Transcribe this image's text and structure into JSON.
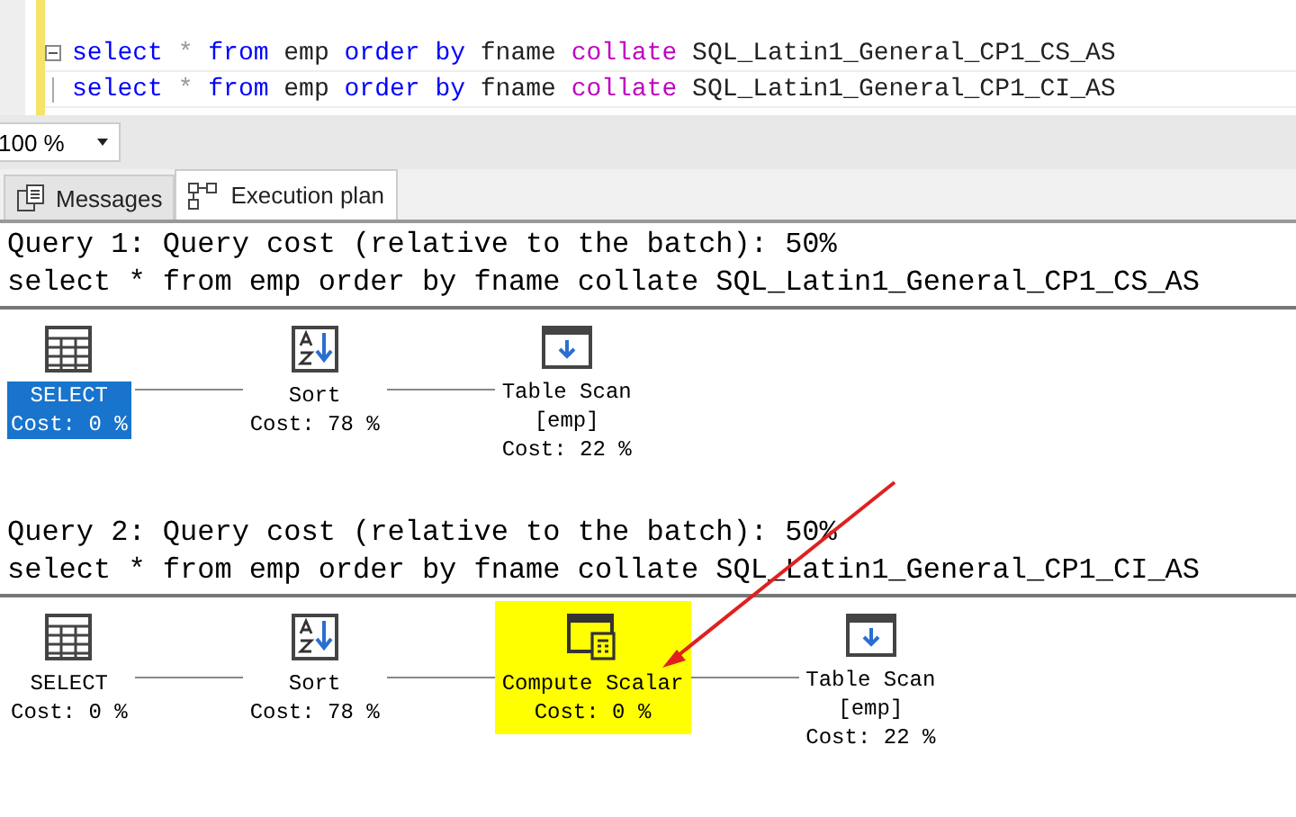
{
  "editor": {
    "lines": [
      {
        "collapsible": true,
        "tokens": [
          {
            "kind": "keyword",
            "text": "select"
          },
          {
            "kind": "operator",
            "text": "*"
          },
          {
            "kind": "keyword",
            "text": "from"
          },
          {
            "kind": "plain",
            "text": "emp"
          },
          {
            "kind": "keyword",
            "text": "order by"
          },
          {
            "kind": "plain",
            "text": "fname"
          },
          {
            "kind": "function",
            "text": "collate"
          },
          {
            "kind": "plain",
            "text": "SQL_Latin1_General_CP1_CS_AS"
          }
        ]
      },
      {
        "collapsible": false,
        "tokens": [
          {
            "kind": "keyword",
            "text": "select"
          },
          {
            "kind": "operator",
            "text": "*"
          },
          {
            "kind": "keyword",
            "text": "from"
          },
          {
            "kind": "plain",
            "text": "emp"
          },
          {
            "kind": "keyword",
            "text": "order by"
          },
          {
            "kind": "plain",
            "text": "fname"
          },
          {
            "kind": "function",
            "text": "collate"
          },
          {
            "kind": "plain",
            "text": "SQL_Latin1_General_CP1_CI_AS"
          }
        ]
      }
    ]
  },
  "zoom": {
    "value": "100 %"
  },
  "tabs": [
    {
      "label": "Messages",
      "kind": "messages",
      "selected": false
    },
    {
      "label": "Execution plan",
      "kind": "plan",
      "selected": true
    }
  ],
  "queries": [
    {
      "header": "Query 1: Query cost (relative to the batch): 50%",
      "statement": "select * from emp order by fname collate SQL_Latin1_General_CP1_CS_AS",
      "nodes": [
        {
          "kind": "select",
          "lines": [
            "SELECT",
            "Cost: 0 %"
          ],
          "selected": true,
          "highlighted": false
        },
        {
          "kind": "sort",
          "lines": [
            "Sort",
            "Cost: 78 %"
          ],
          "selected": false,
          "highlighted": false
        },
        {
          "kind": "scan",
          "lines": [
            "Table Scan",
            "[emp]",
            "Cost: 22 %"
          ],
          "selected": false,
          "highlighted": false
        }
      ]
    },
    {
      "header": "Query 2: Query cost (relative to the batch): 50%",
      "statement": "select * from emp order by fname collate SQL_Latin1_General_CP1_CI_AS",
      "nodes": [
        {
          "kind": "select",
          "lines": [
            "SELECT",
            "Cost: 0 %"
          ],
          "selected": false,
          "highlighted": false
        },
        {
          "kind": "sort",
          "lines": [
            "Sort",
            "Cost: 78 %"
          ],
          "selected": false,
          "highlighted": false
        },
        {
          "kind": "compute",
          "lines": [
            "Compute Scalar",
            "Cost: 0 %"
          ],
          "selected": false,
          "highlighted": true
        },
        {
          "kind": "scan",
          "lines": [
            "Table Scan",
            "[emp]",
            "Cost: 22 %"
          ],
          "selected": false,
          "highlighted": false
        }
      ]
    }
  ],
  "annotation": {
    "kind": "arrow"
  }
}
